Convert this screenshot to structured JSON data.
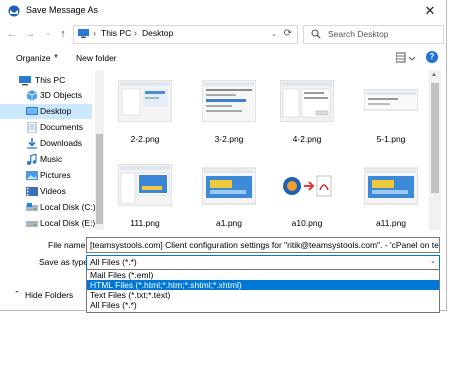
{
  "window": {
    "title": "Save Message As"
  },
  "nav": {
    "back": "←",
    "forward": "→",
    "up": "↑",
    "breadcrumb": [
      "This PC",
      "Desktop"
    ],
    "search_placeholder": "Search Desktop"
  },
  "toolbar": {
    "organize": "Organize",
    "new_folder": "New folder"
  },
  "sidebar": {
    "items": [
      {
        "label": "This PC",
        "icon": "pc-icon"
      },
      {
        "label": "3D Objects",
        "icon": "cube-icon"
      },
      {
        "label": "Desktop",
        "icon": "desktop-icon",
        "selected": true
      },
      {
        "label": "Documents",
        "icon": "documents-icon"
      },
      {
        "label": "Downloads",
        "icon": "download-icon"
      },
      {
        "label": "Music",
        "icon": "music-icon"
      },
      {
        "label": "Pictures",
        "icon": "pictures-icon"
      },
      {
        "label": "Videos",
        "icon": "video-icon"
      },
      {
        "label": "Local Disk (C:)",
        "icon": "disk-icon"
      },
      {
        "label": "Local Disk (E:)",
        "icon": "disk-icon"
      }
    ]
  },
  "files": [
    {
      "name": "2-2.png"
    },
    {
      "name": "3-2.png"
    },
    {
      "name": "4-2.png"
    },
    {
      "name": "5-1.png"
    },
    {
      "name": "111.png"
    },
    {
      "name": "a1.png"
    },
    {
      "name": "a10.png"
    },
    {
      "name": "a11.png"
    }
  ],
  "form": {
    "file_name_label": "File name:",
    "file_name_value": "[teamsystools.com] Client configuration settings for \"ritik@teamsystools.com\". - 'cPanel on team",
    "save_as_type_label": "Save as type:",
    "save_as_type_value": "All Files (*.*)",
    "type_options": [
      {
        "label": "Mail Files (*.eml)"
      },
      {
        "label": "HTML Files (*.html;*.htm;*.shtml;*.xhtml)",
        "selected": true
      },
      {
        "label": "Text Files (*.txt;*.text)"
      },
      {
        "label": "All Files (*.*)"
      }
    ]
  },
  "footer": {
    "hide_folders": "Hide Folders"
  },
  "colors": {
    "accent": "#0078d7",
    "selection": "#cce8ff",
    "folder": "#e8b94a"
  }
}
